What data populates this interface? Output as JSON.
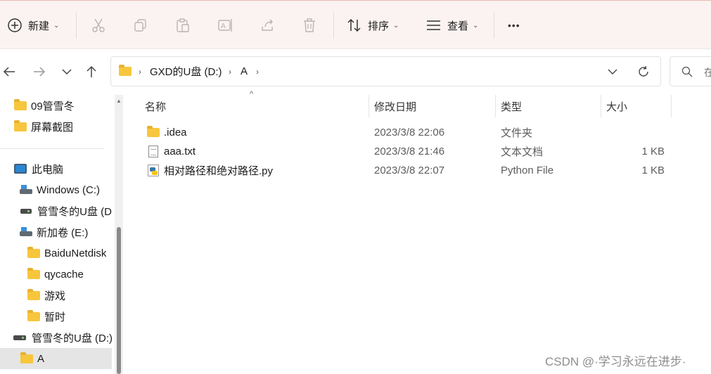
{
  "toolbar": {
    "new_label": "新建",
    "sort_label": "排序",
    "view_label": "查看",
    "more_label": "•••"
  },
  "address": {
    "crumbs": [
      "GXD的U盘 (D:)",
      "A"
    ],
    "search_placeholder": "在"
  },
  "sidebar": {
    "items": [
      {
        "label": "09管雪冬"
      },
      {
        "label": "屏幕截图"
      },
      {
        "label": "此电脑"
      },
      {
        "label": "Windows  (C:)"
      },
      {
        "label": "管雪冬的U盘 (D"
      },
      {
        "label": "新加卷 (E:)"
      },
      {
        "label": "BaiduNetdisk"
      },
      {
        "label": "qycache"
      },
      {
        "label": "游戏"
      },
      {
        "label": "暂时"
      },
      {
        "label": "管雪冬的U盘 (D:)"
      },
      {
        "label": "A"
      }
    ]
  },
  "columns": {
    "name": "名称",
    "modified": "修改日期",
    "type": "类型",
    "size": "大小"
  },
  "files": [
    {
      "name": ".idea",
      "modified": "2023/3/8 22:06",
      "type": "文件夹",
      "size": ""
    },
    {
      "name": "aaa.txt",
      "modified": "2023/3/8 21:46",
      "type": "文本文档",
      "size": "1 KB"
    },
    {
      "name": "相对路径和绝对路径.py",
      "modified": "2023/3/8 22:07",
      "type": "Python File",
      "size": "1 KB"
    }
  ],
  "watermark": "CSDN @·学习永远在进步·",
  "colors": {
    "accent": "#e7b9ae",
    "selected": "#e5e5e5",
    "folder": "#f7c63d"
  }
}
